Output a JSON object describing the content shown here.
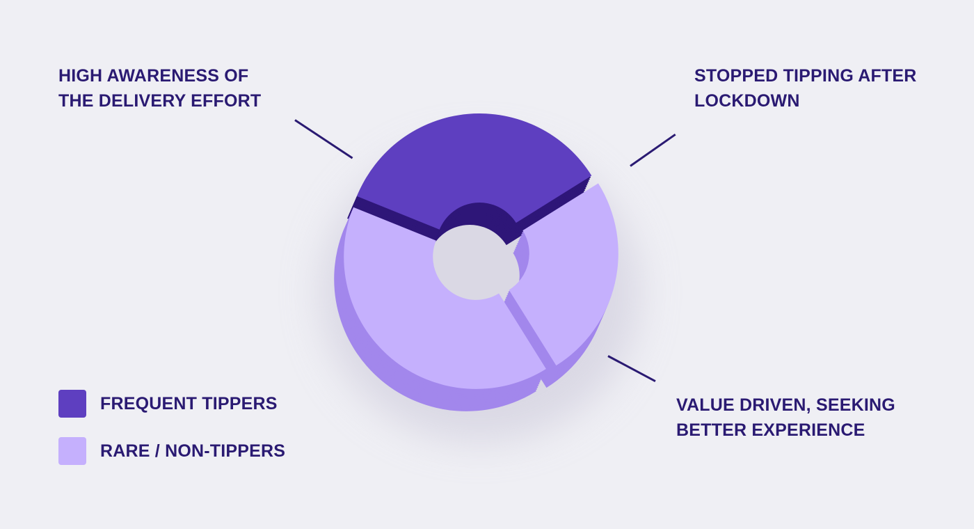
{
  "chart_data": {
    "type": "pie",
    "style": "3d-donut",
    "slices": [
      {
        "label": "HIGH AWARENESS OF THE DELIVERY EFFORT",
        "category": "FREQUENT TIPPERS",
        "value": 35
      },
      {
        "label": "STOPPED TIPPING AFTER LOCKDOWN",
        "category": "RARE / NON-TIPPERS",
        "value": 25
      },
      {
        "label": "VALUE DRIVEN, SEEKING BETTER EXPERIENCE",
        "category": "RARE / NON-TIPPERS",
        "value": 40
      }
    ],
    "legend": {
      "placement": "bottom-left",
      "items": [
        {
          "label": "FREQUENT TIPPERS",
          "color": "#5e3fc0"
        },
        {
          "label": "RARE / NON-TIPPERS",
          "color": "#c5b0fd"
        }
      ]
    }
  },
  "annotations": {
    "top_left": [
      "HIGH AWARENESS OF",
      "THE DELIVERY EFFORT"
    ],
    "top_right": [
      "STOPPED TIPPING AFTER",
      "LOCKDOWN"
    ],
    "bottom_right": [
      "VALUE DRIVEN, SEEKING",
      "BETTER EXPERIENCE"
    ]
  },
  "colors": {
    "background": "#efeff4",
    "text": "#2a1a72",
    "frequent_top": "#5e3fc0",
    "frequent_side": "#2e1678",
    "rare_top": "#c5b0fd",
    "rare_side": "#a287ec"
  }
}
